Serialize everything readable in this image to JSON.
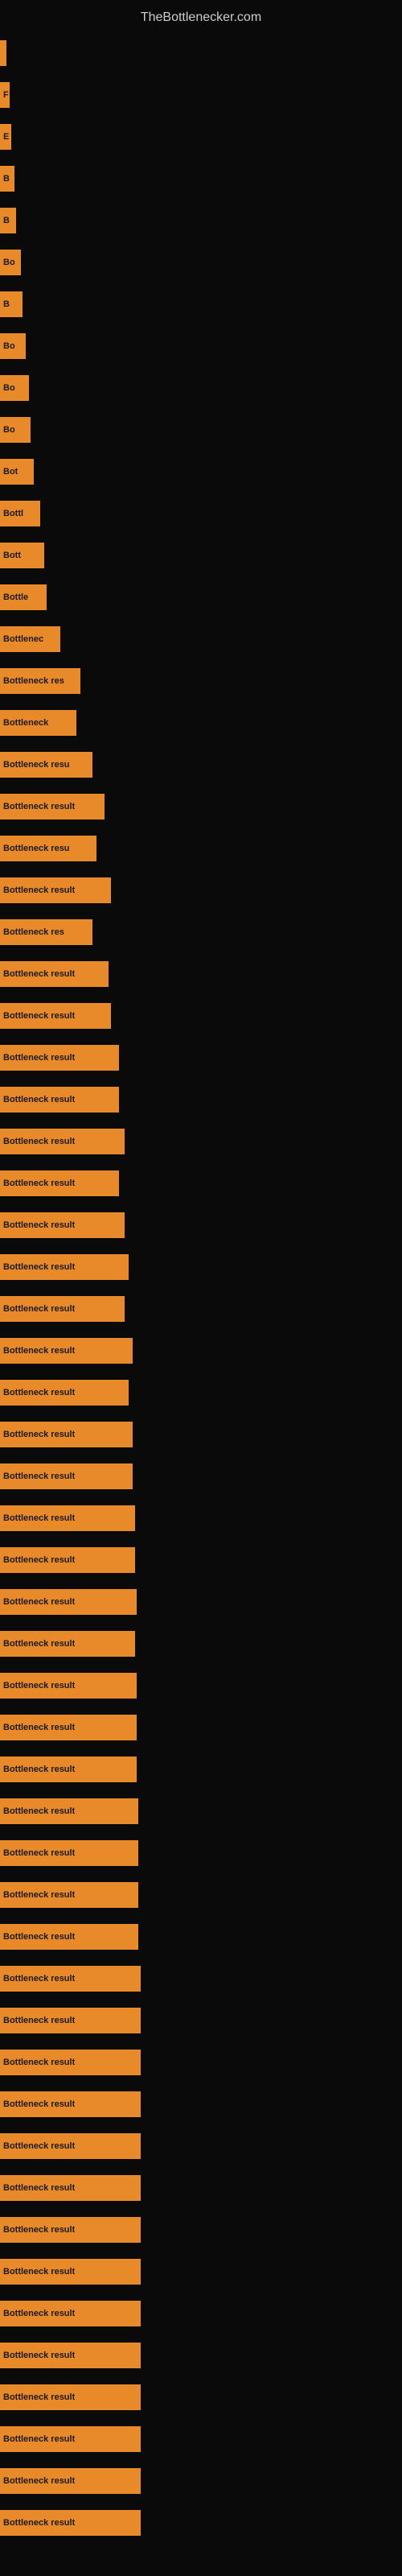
{
  "site": {
    "title": "TheBottlenecker.com"
  },
  "bars": [
    {
      "id": 1,
      "label": "",
      "width_class": "bar-1"
    },
    {
      "id": 2,
      "label": "F",
      "width_class": "bar-2"
    },
    {
      "id": 3,
      "label": "E",
      "width_class": "bar-3"
    },
    {
      "id": 4,
      "label": "B",
      "width_class": "bar-4"
    },
    {
      "id": 5,
      "label": "B",
      "width_class": "bar-5"
    },
    {
      "id": 6,
      "label": "Bo",
      "width_class": "bar-6"
    },
    {
      "id": 7,
      "label": "B",
      "width_class": "bar-7"
    },
    {
      "id": 8,
      "label": "Bo",
      "width_class": "bar-8"
    },
    {
      "id": 9,
      "label": "Bo",
      "width_class": "bar-9"
    },
    {
      "id": 10,
      "label": "Bo",
      "width_class": "bar-10"
    },
    {
      "id": 11,
      "label": "Bot",
      "width_class": "bar-11"
    },
    {
      "id": 12,
      "label": "Bottl",
      "width_class": "bar-12"
    },
    {
      "id": 13,
      "label": "Bott",
      "width_class": "bar-13"
    },
    {
      "id": 14,
      "label": "Bottle",
      "width_class": "bar-14"
    },
    {
      "id": 15,
      "label": "Bottlenec",
      "width_class": "bar-15"
    },
    {
      "id": 16,
      "label": "Bottleneck res",
      "width_class": "bar-16"
    },
    {
      "id": 17,
      "label": "Bottleneck",
      "width_class": "bar-17"
    },
    {
      "id": 18,
      "label": "Bottleneck resu",
      "width_class": "bar-18"
    },
    {
      "id": 19,
      "label": "Bottleneck result",
      "width_class": "bar-19"
    },
    {
      "id": 20,
      "label": "Bottleneck resu",
      "width_class": "bar-20"
    },
    {
      "id": 21,
      "label": "Bottleneck result",
      "width_class": "bar-21"
    },
    {
      "id": 22,
      "label": "Bottleneck res",
      "width_class": "bar-22"
    },
    {
      "id": 23,
      "label": "Bottleneck result",
      "width_class": "bar-23"
    },
    {
      "id": 24,
      "label": "Bottleneck result",
      "width_class": "bar-24"
    },
    {
      "id": 25,
      "label": "Bottleneck result",
      "width_class": "bar-25"
    },
    {
      "id": 26,
      "label": "Bottleneck result",
      "width_class": "bar-26"
    },
    {
      "id": 27,
      "label": "Bottleneck result",
      "width_class": "bar-27"
    },
    {
      "id": 28,
      "label": "Bottleneck result",
      "width_class": "bar-28"
    },
    {
      "id": 29,
      "label": "Bottleneck result",
      "width_class": "bar-29"
    },
    {
      "id": 30,
      "label": "Bottleneck result",
      "width_class": "bar-30"
    },
    {
      "id": 31,
      "label": "Bottleneck result",
      "width_class": "bar-31"
    },
    {
      "id": 32,
      "label": "Bottleneck result",
      "width_class": "bar-32"
    },
    {
      "id": 33,
      "label": "Bottleneck result",
      "width_class": "bar-33"
    },
    {
      "id": 34,
      "label": "Bottleneck result",
      "width_class": "bar-34"
    },
    {
      "id": 35,
      "label": "Bottleneck result",
      "width_class": "bar-35"
    },
    {
      "id": 36,
      "label": "Bottleneck result",
      "width_class": "bar-36"
    },
    {
      "id": 37,
      "label": "Bottleneck result",
      "width_class": "bar-37"
    },
    {
      "id": 38,
      "label": "Bottleneck result",
      "width_class": "bar-38"
    },
    {
      "id": 39,
      "label": "Bottleneck result",
      "width_class": "bar-39"
    },
    {
      "id": 40,
      "label": "Bottleneck result",
      "width_class": "bar-40"
    },
    {
      "id": 41,
      "label": "Bottleneck result",
      "width_class": "bar-41"
    },
    {
      "id": 42,
      "label": "Bottleneck result",
      "width_class": "bar-42"
    },
    {
      "id": 43,
      "label": "Bottleneck result",
      "width_class": "bar-43"
    },
    {
      "id": 44,
      "label": "Bottleneck result",
      "width_class": "bar-44"
    },
    {
      "id": 45,
      "label": "Bottleneck result",
      "width_class": "bar-45"
    },
    {
      "id": 46,
      "label": "Bottleneck result",
      "width_class": "bar-46"
    },
    {
      "id": 47,
      "label": "Bottleneck result",
      "width_class": "bar-47"
    },
    {
      "id": 48,
      "label": "Bottleneck result",
      "width_class": "bar-48"
    },
    {
      "id": 49,
      "label": "Bottleneck result",
      "width_class": "bar-49"
    },
    {
      "id": 50,
      "label": "Bottleneck result",
      "width_class": "bar-50"
    },
    {
      "id": 51,
      "label": "Bottleneck result",
      "width_class": "bar-51"
    },
    {
      "id": 52,
      "label": "Bottleneck result",
      "width_class": "bar-52"
    },
    {
      "id": 53,
      "label": "Bottleneck result",
      "width_class": "bar-53"
    },
    {
      "id": 54,
      "label": "Bottleneck result",
      "width_class": "bar-54"
    },
    {
      "id": 55,
      "label": "Bottleneck result",
      "width_class": "bar-55"
    },
    {
      "id": 56,
      "label": "Bottleneck result",
      "width_class": "bar-56"
    },
    {
      "id": 57,
      "label": "Bottleneck result",
      "width_class": "bar-57"
    },
    {
      "id": 58,
      "label": "Bottleneck result",
      "width_class": "bar-58"
    },
    {
      "id": 59,
      "label": "Bottleneck result",
      "width_class": "bar-59"
    },
    {
      "id": 60,
      "label": "Bottleneck result",
      "width_class": "bar-60"
    }
  ]
}
